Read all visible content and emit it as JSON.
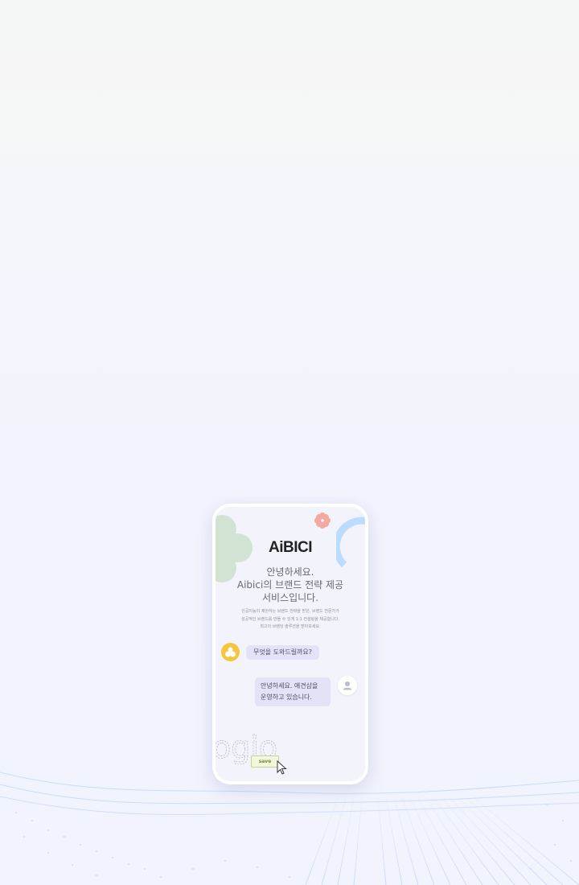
{
  "logo_text": "AiBICI",
  "greeting": {
    "line1": "안녕하세요.",
    "line2": "Aibici의 브랜드 전략 제공",
    "line3": "서비스입니다."
  },
  "description": {
    "line1": "인공지능이 제안하는 브랜드 전략을 받은, 브랜드 전문가가",
    "line2": "성공적인 브랜드를 만들 수 있게 1:1 컨설팅을 제공합니다.",
    "line3": "최고의 브랜딩 솔루션을 받아보세요."
  },
  "chat": {
    "bot_message": "무엇을 도와드릴까요?",
    "user_message_line1": "안녕하세요. 애견샵을",
    "user_message_line2": "운영하고 있습니다."
  },
  "sketch_text": "ogio",
  "save_label": "save",
  "colors": {
    "bot_avatar": "#f6c53e",
    "bubble": "#e2e3f6",
    "flower": "#d2e3d4",
    "pink_flower": "#f4a9a3",
    "arc": "#bcdcff",
    "save_button": "#f2f7dd"
  },
  "icons": [
    "bot-avatar-icon",
    "user-avatar-icon",
    "cursor-icon"
  ]
}
